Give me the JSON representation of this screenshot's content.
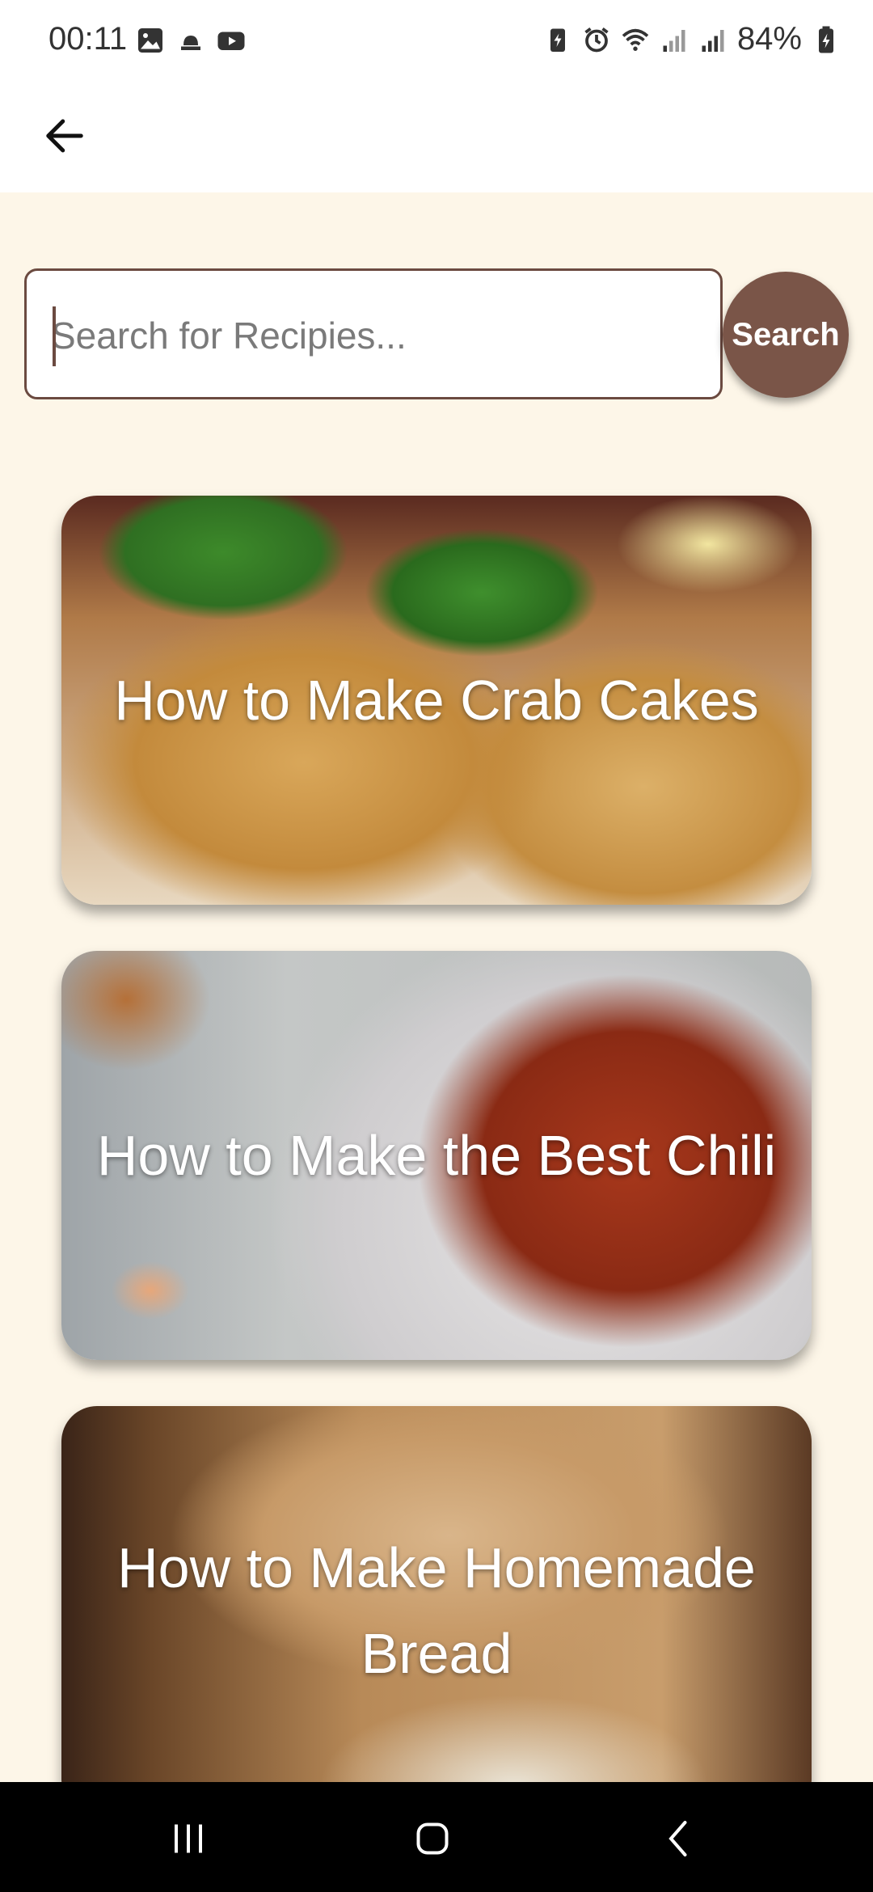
{
  "status_bar": {
    "time": "00:11",
    "battery_text": "84%",
    "left_icons": [
      "gallery-icon",
      "notification-icon",
      "youtube-icon"
    ],
    "right_icons": [
      "battery-saver-icon",
      "alarm-icon",
      "wifi-icon",
      "signal-icon",
      "signal-icon",
      "battery-icon"
    ]
  },
  "app_bar": {
    "back_icon": "arrow-left-icon"
  },
  "search": {
    "placeholder": "Search for Recipies...",
    "value": "",
    "button_label": "Search",
    "accent_color": "#7a5548"
  },
  "recipes": [
    {
      "title": "How to Make Crab Cakes"
    },
    {
      "title": "How to Make the Best Chili"
    },
    {
      "title": "How to Make Homemade Bread"
    }
  ],
  "nav_bar": {
    "buttons": [
      "recent-apps-icon",
      "home-icon",
      "back-icon"
    ]
  }
}
